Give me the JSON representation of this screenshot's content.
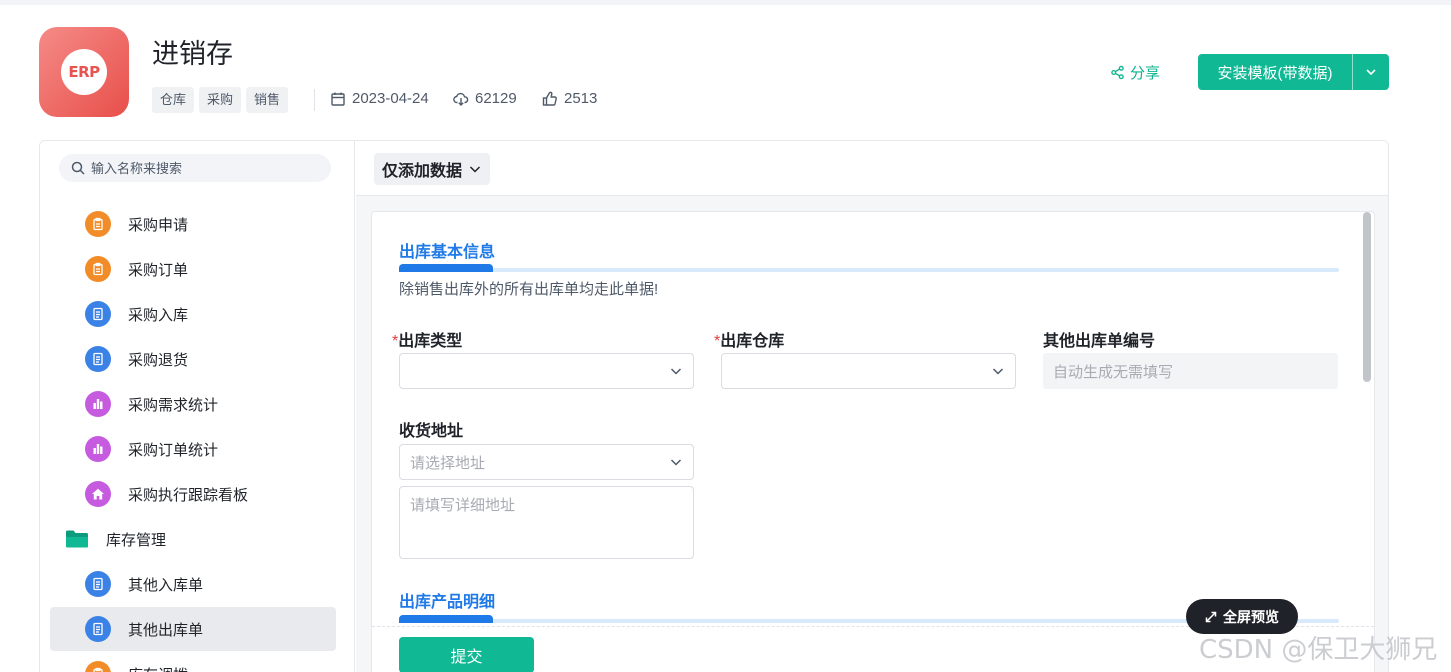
{
  "header": {
    "icon_text": "ERP",
    "title": "进销存",
    "tags": [
      "仓库",
      "采购",
      "销售"
    ],
    "date": "2023-04-24",
    "downloads": "62129",
    "likes": "2513",
    "share_label": "分享",
    "install_label": "安装模板(带数据)"
  },
  "sidebar": {
    "search_placeholder": "输入名称来搜索",
    "items": [
      {
        "label": "采购申请",
        "icon": "clipboard-icon",
        "color": "#f28c28"
      },
      {
        "label": "采购订单",
        "icon": "clipboard-icon",
        "color": "#f28c28"
      },
      {
        "label": "采购入库",
        "icon": "document-icon",
        "color": "#3b82e6"
      },
      {
        "label": "采购退货",
        "icon": "document-icon",
        "color": "#3b82e6"
      },
      {
        "label": "采购需求统计",
        "icon": "bar-chart-icon",
        "color": "#c65be0"
      },
      {
        "label": "采购订单统计",
        "icon": "bar-chart-icon",
        "color": "#c65be0"
      },
      {
        "label": "采购执行跟踪看板",
        "icon": "home-icon",
        "color": "#c65be0"
      },
      {
        "label": "库存管理",
        "icon": "folder-icon",
        "color": "#10b894"
      },
      {
        "label": "其他入库单",
        "icon": "document-icon",
        "color": "#3b82e6"
      },
      {
        "label": "其他出库单",
        "icon": "document-icon",
        "color": "#3b82e6"
      },
      {
        "label": "库存调拨",
        "icon": "clipboard-icon",
        "color": "#f28c28"
      }
    ]
  },
  "content": {
    "mode_label": "仅添加数据",
    "section1_title": "出库基本信息",
    "section1_desc": "除销售出库外的所有出库单均走此单据!",
    "fields": {
      "type_label": "出库类型",
      "warehouse_label": "出库仓库",
      "number_label": "其他出库单编号",
      "number_placeholder": "自动生成无需填写",
      "address_label": "收货地址",
      "address_select_placeholder": "请选择地址",
      "address_detail_placeholder": "请填写详细地址",
      "required_mark": "*"
    },
    "section2_title": "出库产品明细",
    "submit_label": "提交"
  },
  "fullscreen_label": "全屏预览",
  "watermark": "CSDN @保卫大狮兄",
  "colors": {
    "accent_green": "#10b894",
    "accent_blue": "#1f7ae8",
    "required_red": "#e23c39"
  }
}
